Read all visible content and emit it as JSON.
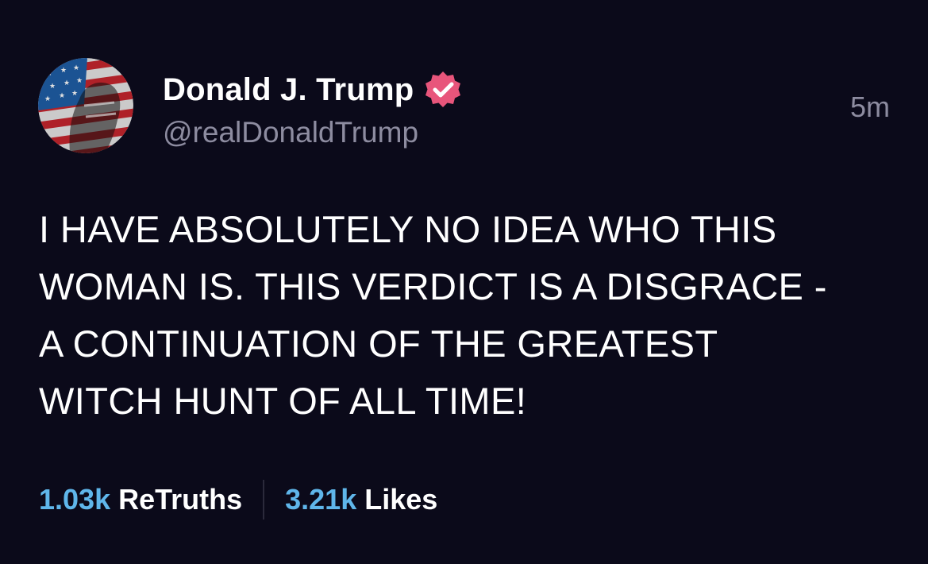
{
  "post": {
    "author": {
      "display_name": "Donald J. Trump",
      "handle": "@realDonaldTrump",
      "verified": true,
      "verified_badge_color": "#e8557b",
      "avatar_icon": "avatar-flag-portrait"
    },
    "timestamp": "5m",
    "text": "I HAVE ABSOLUTELY NO IDEA WHO THIS\nWOMAN IS. THIS VERDICT IS A DISGRACE -\nA CONTINUATION OF THE GREATEST\nWITCH HUNT OF ALL TIME!",
    "stats": {
      "retruths_count": "1.03k",
      "retruths_label": "ReTruths",
      "likes_count": "3.21k",
      "likes_label": "Likes"
    }
  },
  "theme": {
    "background": "#0b0a1a",
    "text_primary": "#ffffff",
    "text_secondary": "#8d8ca0",
    "accent": "#5fb6ea"
  }
}
